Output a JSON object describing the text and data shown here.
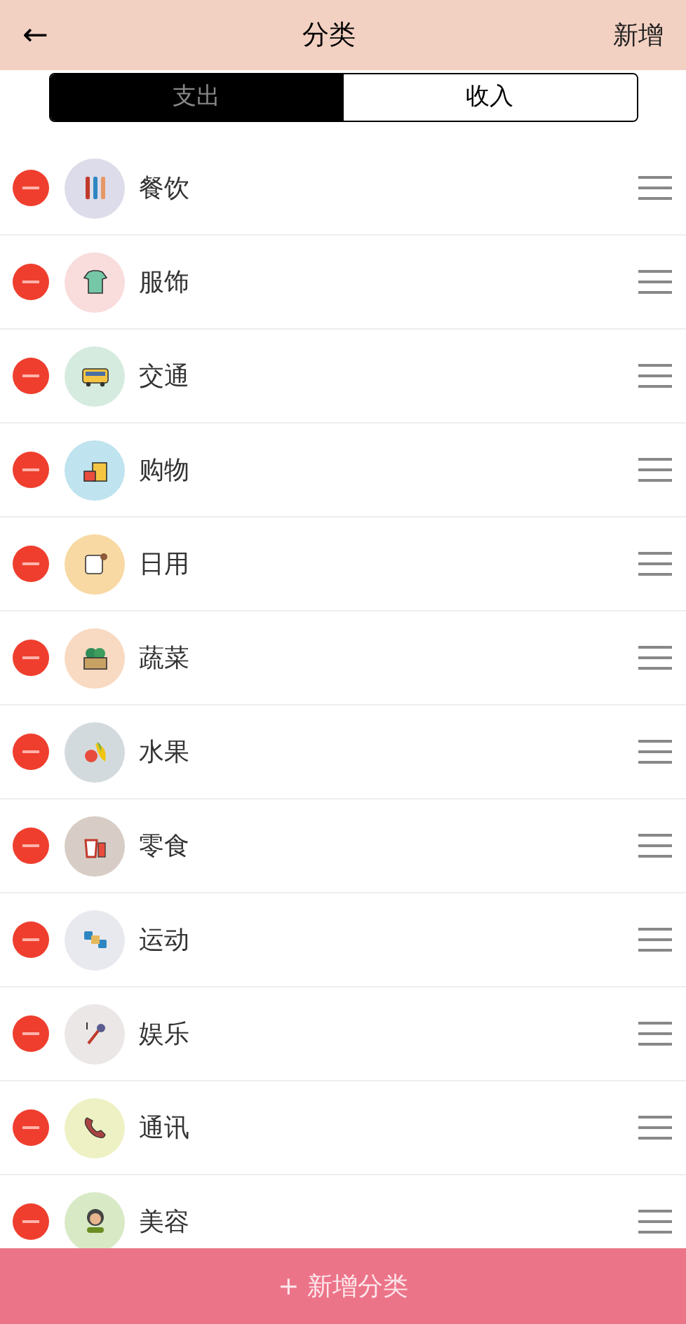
{
  "header": {
    "back": "←",
    "title": "分类",
    "action": "新增"
  },
  "tabs": [
    {
      "label": "支出",
      "selected": true
    },
    {
      "label": "收入",
      "selected": false
    }
  ],
  "categories": [
    {
      "name": "餐饮",
      "color": "#dcdcea",
      "kind": "cutlery"
    },
    {
      "name": "服饰",
      "color": "#f9dcdc",
      "kind": "shirt"
    },
    {
      "name": "交通",
      "color": "#d5ebdf",
      "kind": "bus"
    },
    {
      "name": "购物",
      "color": "#bfe3ef",
      "kind": "bag"
    },
    {
      "name": "日用",
      "color": "#f8d9a3",
      "kind": "tissue"
    },
    {
      "name": "蔬菜",
      "color": "#f8d9c1",
      "kind": "veg"
    },
    {
      "name": "水果",
      "color": "#d3dade",
      "kind": "fruit"
    },
    {
      "name": "零食",
      "color": "#d8cdc6",
      "kind": "snack"
    },
    {
      "name": "运动",
      "color": "#e8e9ee",
      "kind": "dumbbell"
    },
    {
      "name": "娱乐",
      "color": "#ebe7e6",
      "kind": "mic"
    },
    {
      "name": "通讯",
      "color": "#eef1c4",
      "kind": "phone"
    },
    {
      "name": "美容",
      "color": "#d8e9c6",
      "kind": "person"
    }
  ],
  "add_button": "+ 新增分类"
}
